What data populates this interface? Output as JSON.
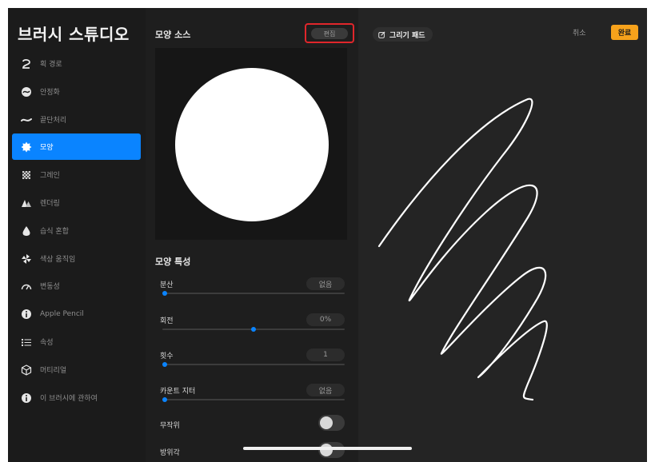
{
  "sidebar": {
    "title": "브러시 스튜디오",
    "items": [
      {
        "label": "획 경로",
        "icon": "stroke-path-icon",
        "active": false
      },
      {
        "label": "안정화",
        "icon": "stabilization-icon",
        "active": false
      },
      {
        "label": "끝단처리",
        "icon": "taper-icon",
        "active": false
      },
      {
        "label": "모양",
        "icon": "shape-icon",
        "active": true
      },
      {
        "label": "그레인",
        "icon": "grain-icon",
        "active": false
      },
      {
        "label": "렌더링",
        "icon": "rendering-icon",
        "active": false
      },
      {
        "label": "습식 혼합",
        "icon": "wet-mix-icon",
        "active": false
      },
      {
        "label": "색상 움직임",
        "icon": "color-dynamics-icon",
        "active": false
      },
      {
        "label": "변동성",
        "icon": "dynamics-icon",
        "active": false
      },
      {
        "label": "Apple Pencil",
        "icon": "apple-pencil-icon",
        "active": false
      },
      {
        "label": "속성",
        "icon": "properties-icon",
        "active": false
      },
      {
        "label": "머티리얼",
        "icon": "materials-icon",
        "active": false
      },
      {
        "label": "이 브러시에 관하여",
        "icon": "about-icon",
        "active": false
      }
    ]
  },
  "shape_source": {
    "title": "모양 소스",
    "edit_label": "편집"
  },
  "shape_properties": {
    "title": "모양 특성",
    "sliders": [
      {
        "label": "분산",
        "value": "없음",
        "level": 0.0
      },
      {
        "label": "회전",
        "value": "0%",
        "level": 0.5
      },
      {
        "label": "횟수",
        "value": "1",
        "level": 0.0
      },
      {
        "label": "카운트 지터",
        "value": "없음",
        "level": 0.0
      }
    ],
    "toggles": [
      {
        "label": "무작위",
        "on": false
      },
      {
        "label": "방위각",
        "on": false
      }
    ]
  },
  "drawing_pad": {
    "title": "그리기 패드",
    "cancel_label": "취소",
    "done_label": "완료"
  },
  "colors": {
    "accent": "#0a84ff",
    "done": "#f7a21b",
    "highlight_box": "#e0262b"
  }
}
